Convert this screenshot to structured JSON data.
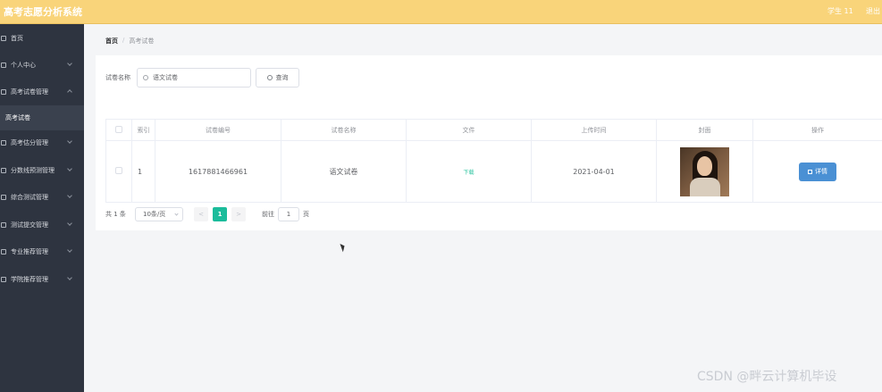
{
  "header": {
    "app_title": "高考志愿分析系统",
    "user": "学生 11",
    "logout": "退出"
  },
  "sidebar": {
    "items": [
      {
        "label": "首页",
        "icon": "home-icon",
        "expandable": false
      },
      {
        "label": "个人中心",
        "icon": "user-icon",
        "expandable": true
      },
      {
        "label": "高考试卷管理",
        "icon": "paper-icon",
        "expandable": true,
        "expanded": true
      },
      {
        "label": "高考估分管理",
        "icon": "list-icon",
        "expandable": true
      },
      {
        "label": "分数线预测管理",
        "icon": "chart-icon",
        "expandable": true
      },
      {
        "label": "综合测试管理",
        "icon": "test-icon",
        "expandable": true
      },
      {
        "label": "测试提交管理",
        "icon": "upload-icon",
        "expandable": true
      },
      {
        "label": "专业推荐管理",
        "icon": "major-icon",
        "expandable": true
      },
      {
        "label": "学院推荐管理",
        "icon": "college-icon",
        "expandable": true
      }
    ],
    "active_sub": "高考试卷"
  },
  "breadcrumb": {
    "home": "首页",
    "separator": "/",
    "current": "高考试卷"
  },
  "search": {
    "label": "试卷名称",
    "value": "语文试卷",
    "button": "查询"
  },
  "table": {
    "headers": [
      "",
      "索引",
      "试卷编号",
      "试卷名称",
      "文件",
      "上传时间",
      "封面",
      "操作"
    ],
    "rows": [
      {
        "index": "1",
        "paper_no": "1617881466961",
        "paper_name": "语文试卷",
        "file_link": "下载",
        "upload_time": "2021-04-01",
        "action": "详情"
      }
    ]
  },
  "pagination": {
    "total": "共 1 条",
    "page_size": "10条/页",
    "prev": "<",
    "current_page": "1",
    "next": ">",
    "goto_label": "前往",
    "goto_value": "1",
    "page_unit": "页"
  },
  "watermark": "CSDN @畔云计算机毕设",
  "colors": {
    "topbar": "#f9d47a",
    "sidebar": "#2e3440",
    "accent": "#1bbc9b",
    "detail_button": "#4a90d4"
  }
}
